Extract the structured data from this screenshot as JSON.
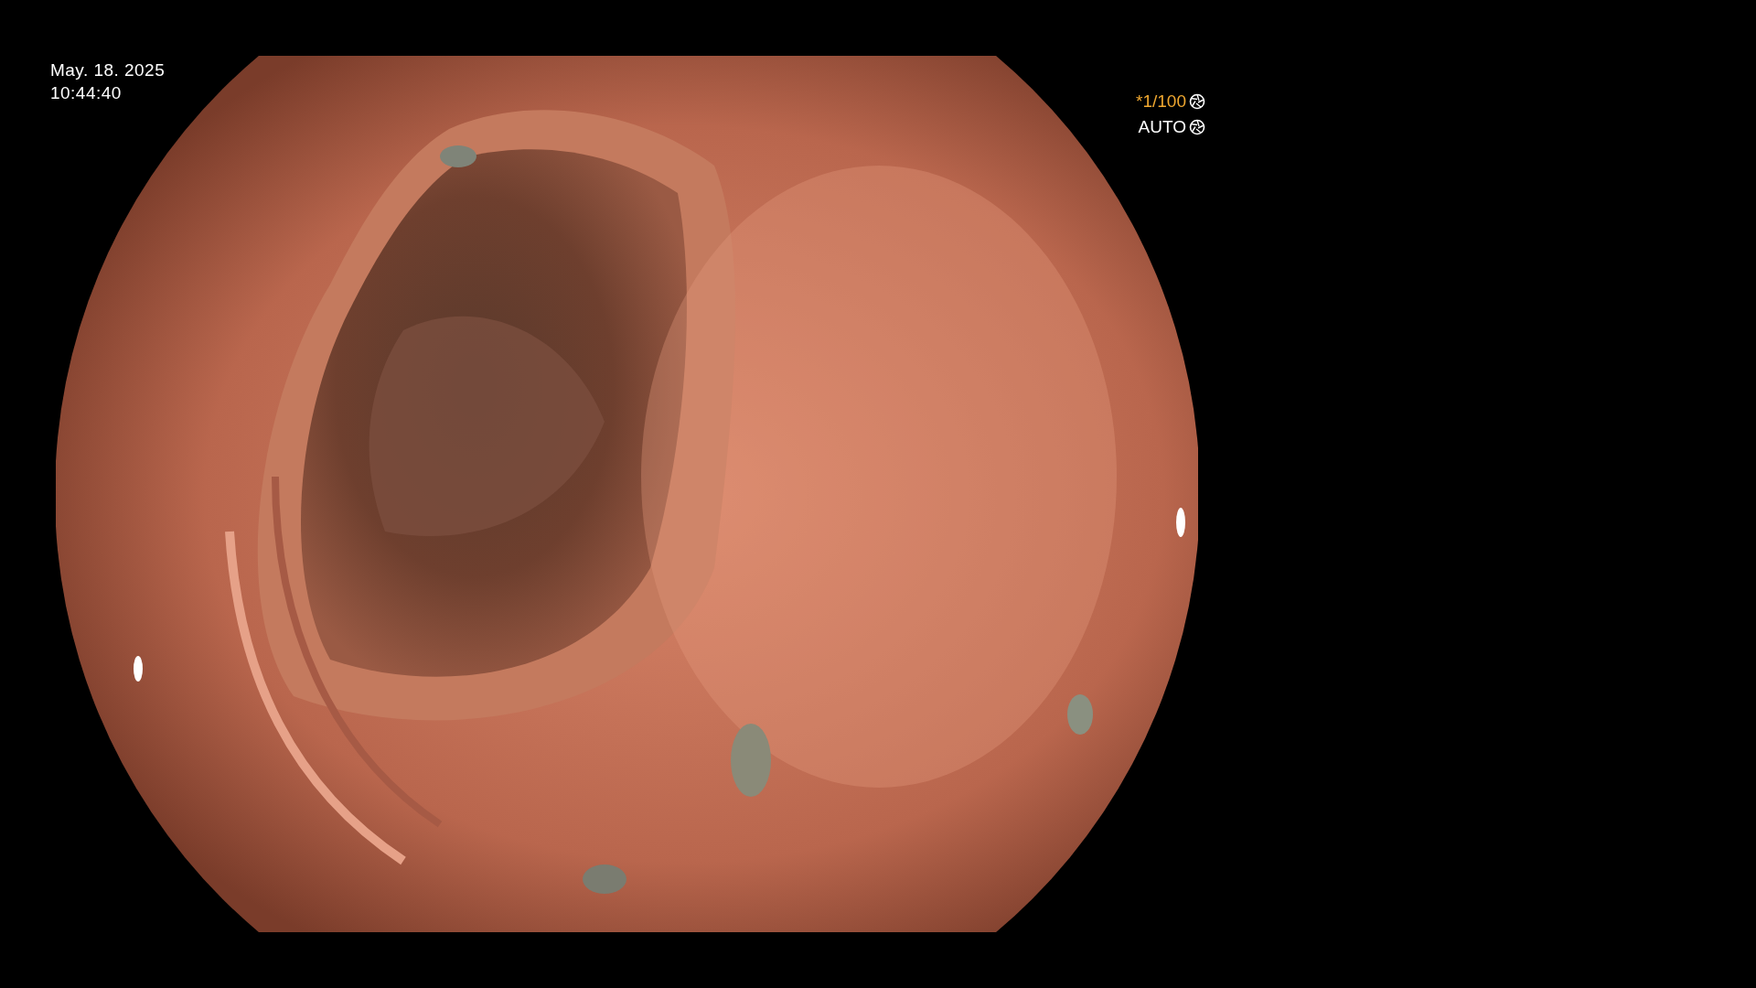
{
  "timestamp": {
    "date": "May. 18. 2025",
    "time": "10:44:40"
  },
  "exposure": {
    "shutter": "*1/100",
    "mode": "AUTO"
  }
}
